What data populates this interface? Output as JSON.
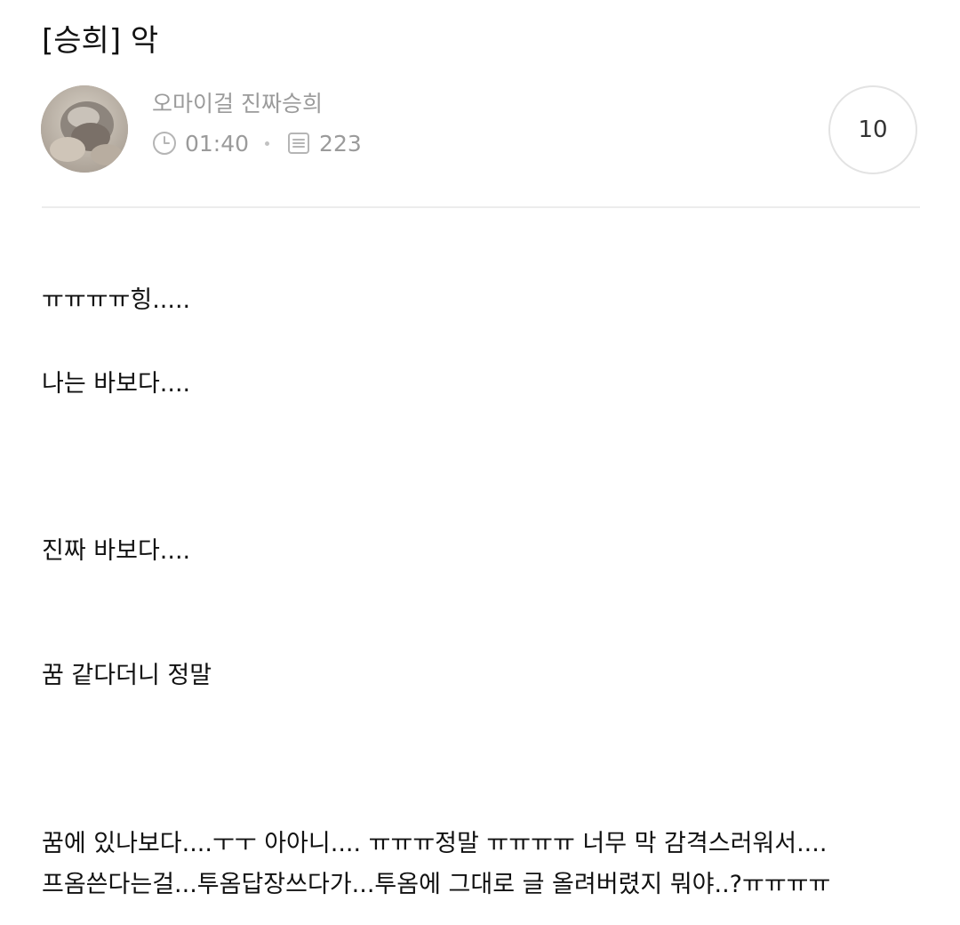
{
  "post": {
    "title": "[승희] 악",
    "author": "오마이걸 진짜승희",
    "time": "01:40",
    "views": "223",
    "count_badge": "10",
    "icons": {
      "avatar": "profile-photo",
      "time": "clock-icon",
      "views": "document-icon"
    }
  },
  "body": {
    "lines": [
      "ㅠㅠㅠㅠ힝.....",
      "나는 바보다....",
      "진짜 바보다....",
      "꿈 같다더니 정말",
      "꿈에 있나보다....ㅜㅜ 아아니.... ㅠㅠㅠ정말 ㅠㅠㅠㅠ 너무 막 감격스러워서....",
      "프옴쓴다는걸...투옴답장쓰다가...투옴에 그대로 글 올려버렸지 뭐야..?ㅠㅠㅠㅠ"
    ]
  },
  "colors": {
    "text": "#111111",
    "meta": "#9b9b9b",
    "divider": "#ececec",
    "badge_border": "#e3e3e3"
  }
}
